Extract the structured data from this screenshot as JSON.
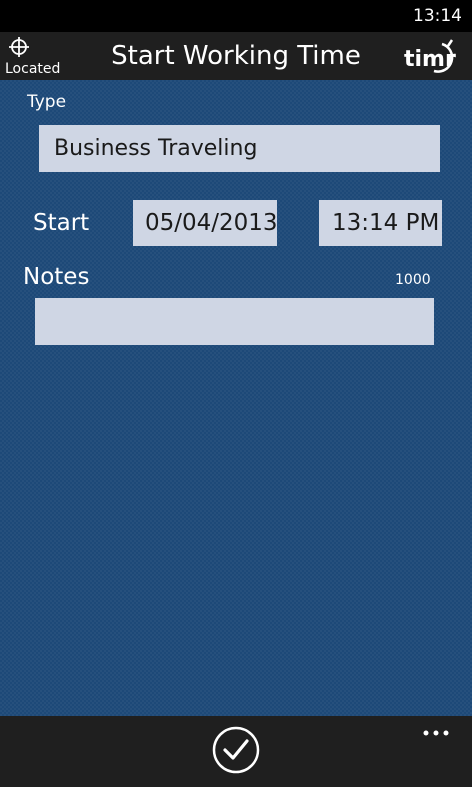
{
  "status_bar": {
    "time": "13:14"
  },
  "header": {
    "location_label": "Located",
    "title": "Start Working Time",
    "logo_text": "timr"
  },
  "form": {
    "type_label": "Type",
    "type_value": "Business Traveling",
    "start_label": "Start",
    "start_date": "05/04/2013",
    "start_time": "13:14 PM",
    "notes_label": "Notes",
    "notes_counter": "1000",
    "notes_value": ""
  },
  "app_bar": {
    "confirm_icon": "check-circle-icon",
    "more_icon": "ellipsis-icon"
  },
  "colors": {
    "content_bg": "#1d4978",
    "field_bg": "#cfd6e4",
    "chrome_bg": "#1f1f1f"
  }
}
